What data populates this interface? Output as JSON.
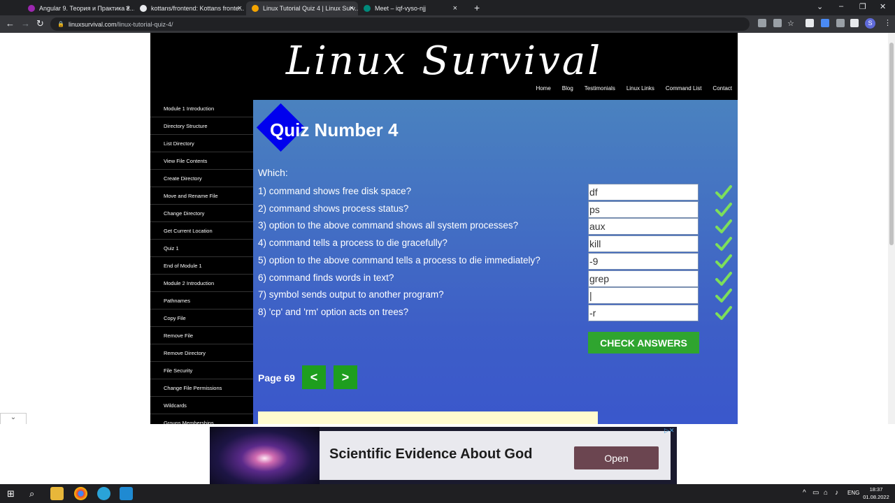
{
  "browser": {
    "tabs": [
      {
        "title": "Angular 9. Теория и Практика 2...",
        "color": "#9c27b0"
      },
      {
        "title": "kottans/frontend: Kottans fronte...",
        "color": "#e8eaed"
      },
      {
        "title": "Linux Tutorial Quiz 4 | Linux Surv...",
        "color": "#f4a400"
      },
      {
        "title": "Meet – iqf-vyso-njj",
        "color": "#00897b"
      }
    ],
    "url_host": "linuxsurvival.com",
    "url_path": "/linux-tutorial-quiz-4/",
    "profile_initial": "S"
  },
  "site": {
    "logo": "Linux Survival",
    "nav": [
      "Home",
      "Blog",
      "Testimonials",
      "Linux Links",
      "Command List",
      "Contact"
    ],
    "sidebar": [
      "Module 1 Introduction",
      "Directory Structure",
      "List Directory",
      "View File Contents",
      "Create Directory",
      "Move and Rename File",
      "Change Directory",
      "Get Current Location",
      "Quiz 1",
      "End of Module 1",
      "Module 2 Introduction",
      "Pathnames",
      "Copy File",
      "Remove File",
      "Remove Directory",
      "File Security",
      "Change File Permissions",
      "Wildcards",
      "Groups Memberships"
    ]
  },
  "quiz": {
    "title": "Quiz Number 4",
    "prompt": "Which:",
    "questions": [
      {
        "text": "1) command shows free disk space?",
        "answer": "df",
        "correct": true
      },
      {
        "text": "2) command shows process status?",
        "answer": "ps",
        "correct": true
      },
      {
        "text": "3) option to the above command shows all system processes?",
        "answer": "aux",
        "correct": true
      },
      {
        "text": "4) command tells a process to die gracefully?",
        "answer": "kill",
        "correct": true
      },
      {
        "text": "5) option to the above command tells a process to die immediately?",
        "answer": "-9",
        "correct": true
      },
      {
        "text": "6) command finds words in text?",
        "answer": "grep",
        "correct": true
      },
      {
        "text": "7) symbol sends output to another program?",
        "answer": "|",
        "correct": true
      },
      {
        "text": "8) 'cp' and 'rm' option acts on trees?",
        "answer": "-r",
        "correct": true
      }
    ],
    "check_label": "CHECK ANSWERS",
    "page_label": "Page 69",
    "prev_label": "<",
    "next_label": ">"
  },
  "ad": {
    "headline": "Scientific Evidence About God",
    "button": "Open"
  },
  "taskbar": {
    "lang": "ENG",
    "time": "18:37",
    "date": "01.08.2022"
  }
}
